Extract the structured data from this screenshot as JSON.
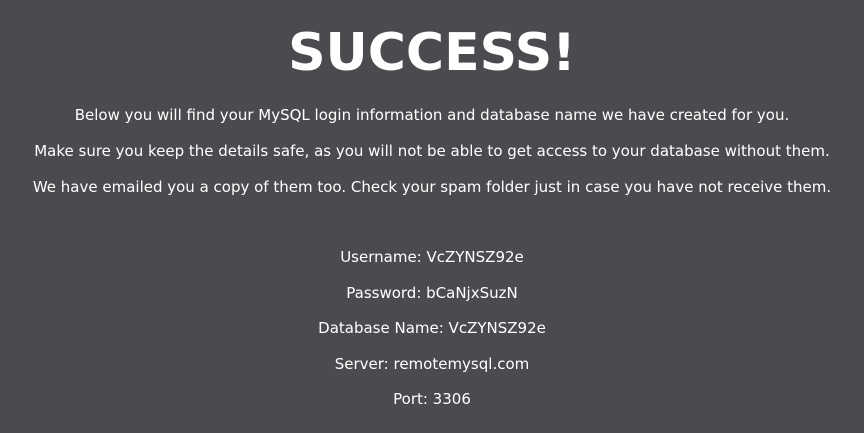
{
  "heading": "SUCCESS!",
  "intro": {
    "line1": "Below you will find your MySQL login information and database name we have created for you.",
    "line2": "Make sure you keep the details safe, as you will not be able to get access to your database without them.",
    "line3": "We have emailed you a copy of them too. Check your spam folder just in case you have not receive them."
  },
  "credentials": {
    "username": "Username: VcZYNSZ92e",
    "password": "Password: bCaNjxSuzN",
    "database_name": "Database Name: VcZYNSZ92e",
    "server": "Server: remotemysql.com",
    "port": "Port: 3306"
  },
  "colors": {
    "background": "#4a4b4f",
    "text": "#ffffff"
  }
}
